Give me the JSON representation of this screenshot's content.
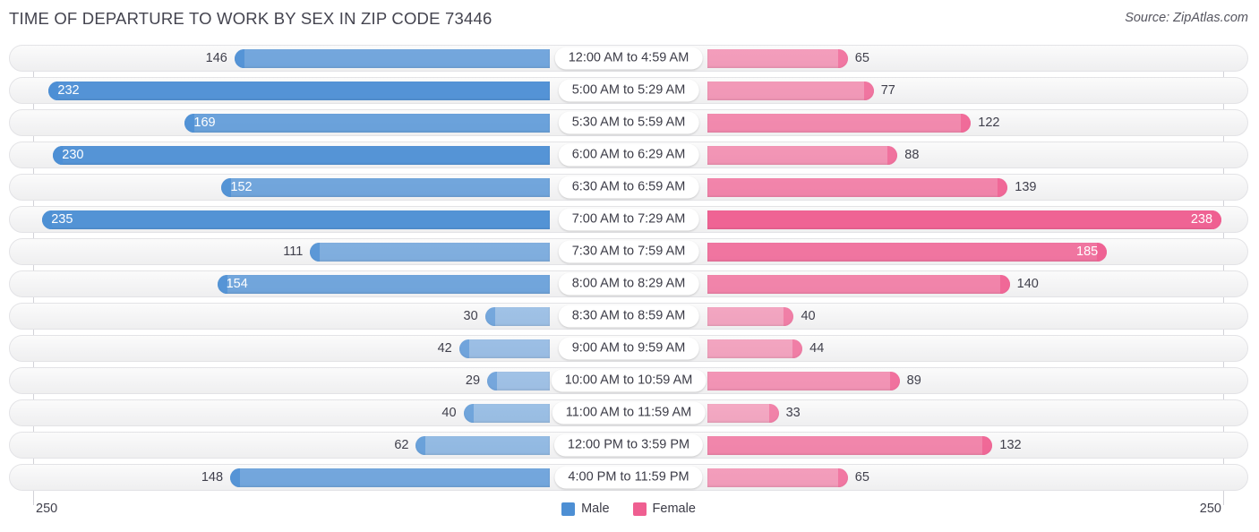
{
  "header": {
    "title": "TIME OF DEPARTURE TO WORK BY SEX IN ZIP CODE 73446",
    "source": "Source: ZipAtlas.com"
  },
  "footer": {
    "axis_max_left": "250",
    "axis_max_right": "250"
  },
  "legend": [
    {
      "label": "Male",
      "color": "#4d8fd4"
    },
    {
      "label": "Female",
      "color": "#ef5f91"
    }
  ],
  "colors": {
    "male": "#4d8fd4",
    "female": "#ef5f91",
    "row_background": "#f4f4f5",
    "row_border": "#e3e3e6",
    "label_dark": "#40404c",
    "label_light": "#ffffff"
  },
  "chart_data": {
    "type": "bar",
    "subtype": "diverging-horizontal-butterfly",
    "title": "TIME OF DEPARTURE TO WORK BY SEX IN ZIP CODE 73446",
    "xlabel": "",
    "ylabel": "",
    "xlim": [
      0,
      250
    ],
    "axis_max": 250,
    "grid": false,
    "legend_position": "bottom-center",
    "categories": [
      "12:00 AM to 4:59 AM",
      "5:00 AM to 5:29 AM",
      "5:30 AM to 5:59 AM",
      "6:00 AM to 6:29 AM",
      "6:30 AM to 6:59 AM",
      "7:00 AM to 7:29 AM",
      "7:30 AM to 7:59 AM",
      "8:00 AM to 8:29 AM",
      "8:30 AM to 8:59 AM",
      "9:00 AM to 9:59 AM",
      "10:00 AM to 10:59 AM",
      "11:00 AM to 11:59 AM",
      "12:00 PM to 3:59 PM",
      "4:00 PM to 11:59 PM"
    ],
    "series": [
      {
        "name": "Male",
        "color": "#4d8fd4",
        "side": "left",
        "values": [
          146,
          232,
          169,
          230,
          152,
          235,
          111,
          154,
          30,
          42,
          29,
          40,
          62,
          148
        ]
      },
      {
        "name": "Female",
        "color": "#ef5f91",
        "side": "right",
        "values": [
          65,
          77,
          122,
          88,
          139,
          238,
          185,
          140,
          40,
          44,
          89,
          33,
          132,
          65
        ]
      }
    ]
  }
}
